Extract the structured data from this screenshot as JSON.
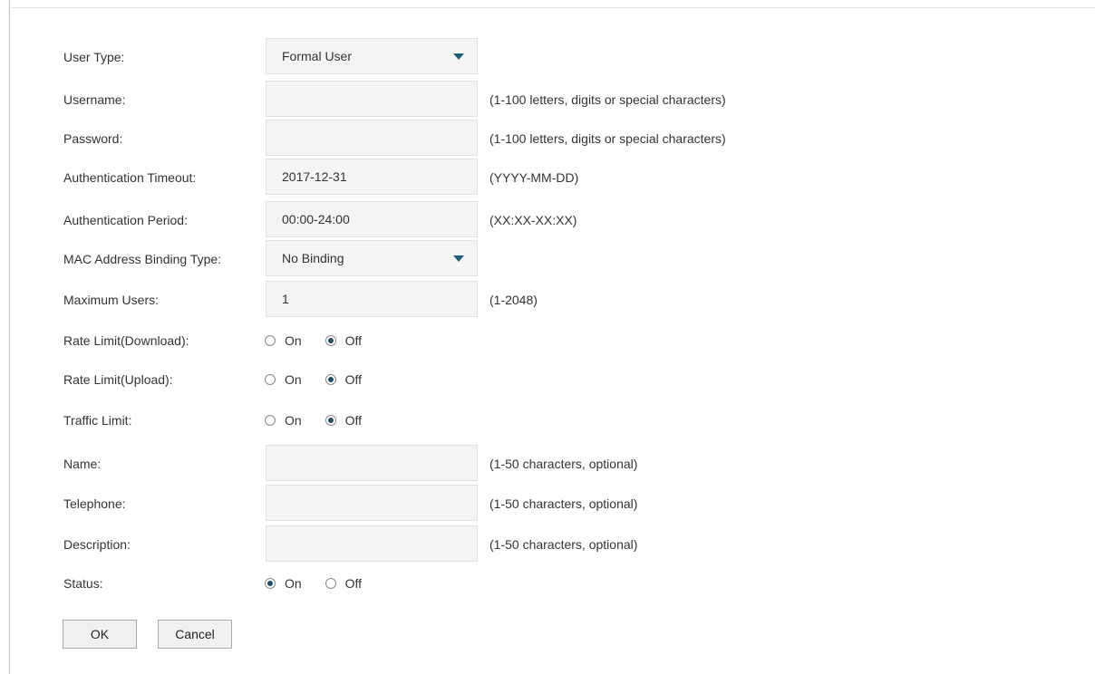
{
  "form": {
    "user_type": {
      "label": "User Type:",
      "value": "Formal User"
    },
    "username": {
      "label": "Username:",
      "value": "",
      "hint": "(1-100 letters, digits or special characters)"
    },
    "password": {
      "label": "Password:",
      "value": "",
      "hint": "(1-100 letters, digits or special characters)"
    },
    "auth_timeout": {
      "label": "Authentication Timeout:",
      "value": "2017-12-31",
      "hint": "(YYYY-MM-DD)"
    },
    "auth_period": {
      "label": "Authentication Period:",
      "value": "00:00-24:00",
      "hint": "(XX:XX-XX:XX)"
    },
    "mac_binding": {
      "label": "MAC Address Binding Type:",
      "value": "No Binding"
    },
    "max_users": {
      "label": "Maximum Users:",
      "value": "1",
      "hint": "(1-2048)"
    },
    "rate_down": {
      "label": "Rate Limit(Download):",
      "on": "On",
      "off": "Off",
      "selected": "off"
    },
    "rate_up": {
      "label": "Rate Limit(Upload):",
      "on": "On",
      "off": "Off",
      "selected": "off"
    },
    "traffic": {
      "label": "Traffic Limit:",
      "on": "On",
      "off": "Off",
      "selected": "off"
    },
    "name": {
      "label": "Name:",
      "value": "",
      "hint": "(1-50 characters, optional)"
    },
    "telephone": {
      "label": "Telephone:",
      "value": "",
      "hint": "(1-50 characters, optional)"
    },
    "description": {
      "label": "Description:",
      "value": "",
      "hint": "(1-50 characters, optional)"
    },
    "status": {
      "label": "Status:",
      "on": "On",
      "off": "Off",
      "selected": "on"
    }
  },
  "buttons": {
    "ok": "OK",
    "cancel": "Cancel"
  },
  "colors": {
    "radio_dot": "#1d4f68",
    "caret": "#1d5d7a",
    "input_bg": "#f4f4f4"
  }
}
